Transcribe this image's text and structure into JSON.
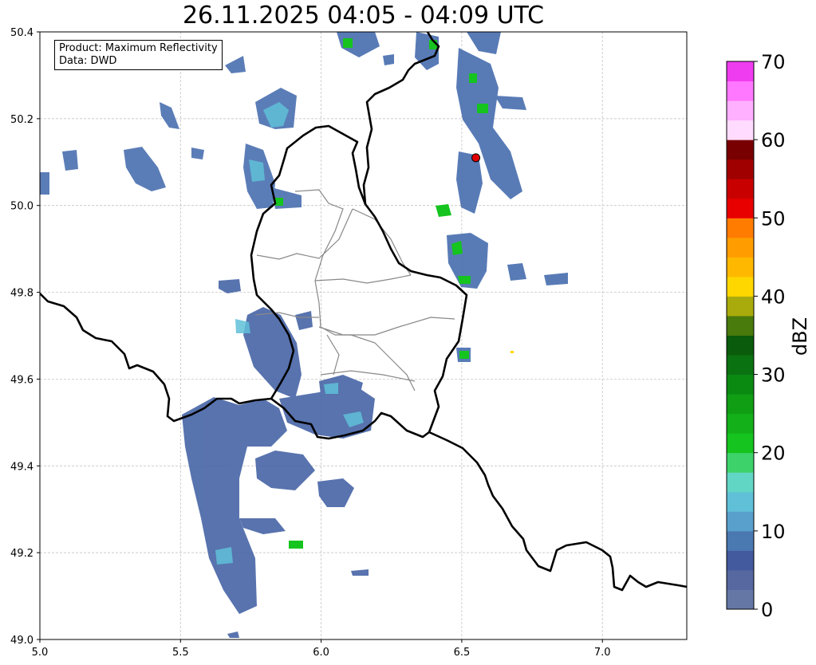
{
  "title": "26.11.2025 04:05 - 04:09 UTC",
  "info": {
    "product": "Product: Maximum Reflectivity",
    "source": "Data: DWD"
  },
  "map": {
    "lon_range": [
      5.0,
      7.3
    ],
    "lat_range": [
      49.0,
      50.4
    ],
    "x_ticks": [
      "5.0",
      "5.5",
      "6.0",
      "6.5",
      "7.0"
    ],
    "y_ticks": [
      "49.0",
      "49.2",
      "49.4",
      "49.6",
      "49.8",
      "50.0",
      "50.2",
      "50.4"
    ],
    "grid": true,
    "marker": {
      "lon": 6.55,
      "lat": 50.11,
      "color": "#e00000"
    }
  },
  "colorbar": {
    "label": "dBZ",
    "ticks": [
      "0",
      "10",
      "20",
      "30",
      "40",
      "50",
      "60",
      "70"
    ],
    "range": [
      0,
      70
    ],
    "colors": [
      "#6477a5",
      "#56689f",
      "#445a9e",
      "#4a78b0",
      "#5aa0cc",
      "#5fc0d8",
      "#62d6c4",
      "#3ed36a",
      "#15c41e",
      "#13b01a",
      "#109e14",
      "#0b8a12",
      "#0a7210",
      "#0a5c0c",
      "#487a0c",
      "#a9ab0c",
      "#ffd700",
      "#ffb800",
      "#ff9d00",
      "#ff7c00",
      "#e80000",
      "#c80000",
      "#a00000",
      "#780000",
      "#ffdcff",
      "#ffb0ff",
      "#ff78ff",
      "#f03cf0"
    ]
  }
}
